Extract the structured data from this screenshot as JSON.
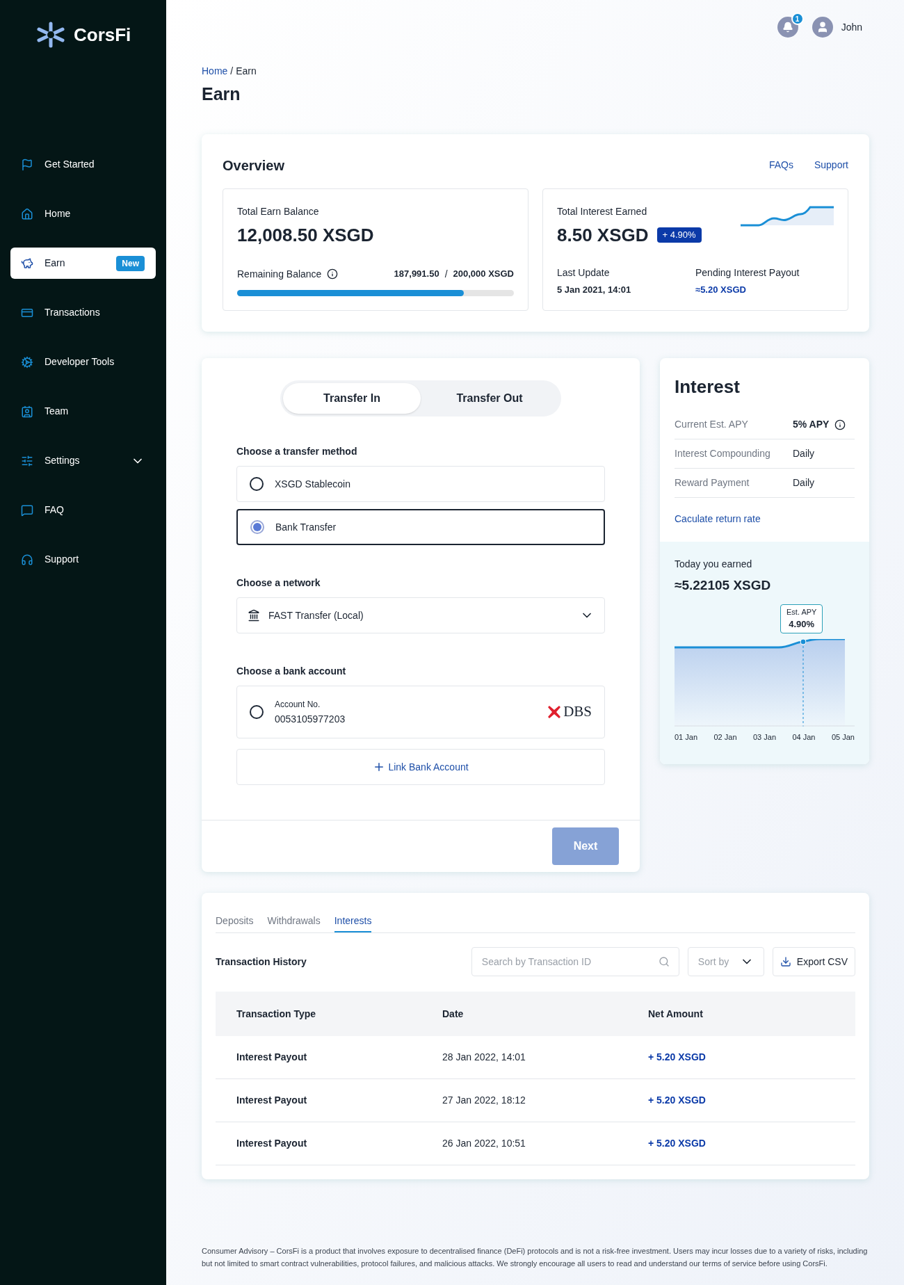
{
  "brand": "CorsFi",
  "sidebar": {
    "items": [
      {
        "label": "Get Started",
        "kind": "link",
        "selected": false
      },
      {
        "label": "Home",
        "kind": "link",
        "selected": false
      },
      {
        "label": "Earn",
        "kind": "link",
        "selected": true,
        "badge": "New"
      },
      {
        "label": "Transactions",
        "kind": "link",
        "selected": false
      },
      {
        "label": "Developer Tools",
        "kind": "link",
        "selected": false
      },
      {
        "label": "Team",
        "kind": "link",
        "selected": false
      },
      {
        "label": "Settings",
        "kind": "group",
        "selected": false,
        "expanded": false
      },
      {
        "label": "FAQ",
        "kind": "link",
        "selected": false
      },
      {
        "label": "Support",
        "kind": "link",
        "selected": false
      }
    ]
  },
  "header": {
    "notification_count": "1",
    "user_name": "John"
  },
  "breadcrumb": {
    "link": "Home",
    "separator": "/",
    "current": "Earn"
  },
  "page_title": "Earn",
  "overview": {
    "title": "Overview",
    "links": [
      "FAQs",
      "Support"
    ],
    "balance": {
      "label": "Total Earn Balance",
      "value": "12,008.50 XSGD",
      "remaining_label": "Remaining Balance",
      "remaining_used": "187,991.50",
      "remaining_separator": "/",
      "remaining_total": "200,000 XSGD",
      "level": 0.82
    },
    "interest": {
      "label": "Total Interest Earned",
      "value": "8.50 XSGD",
      "change": "+ 4.90%",
      "last_update_label": "Last Update",
      "last_update": "5 Jan 2021, 14:01",
      "pending_label": "Pending Interest Payout",
      "pending": "≈5.20 XSGD"
    }
  },
  "transfer": {
    "tabs": [
      {
        "label": "Transfer In",
        "selected": true
      },
      {
        "label": "Transfer Out",
        "selected": false
      }
    ],
    "method_label": "Choose a transfer method",
    "methods": [
      {
        "label": "XSGD Stablecoin",
        "selected": false
      },
      {
        "label": "Bank Transfer",
        "selected": true
      }
    ],
    "network_label": "Choose a network",
    "network": "FAST Transfer (Local)",
    "account_label": "Choose a bank account",
    "accounts": [
      {
        "label": "Account No.",
        "number": "0053105977203",
        "bank": "DBS",
        "selected": false
      }
    ],
    "link_account": "Link Bank Account",
    "next": "Next",
    "next_disabled": true
  },
  "interest": {
    "title": "Interest",
    "rows": [
      {
        "label": "Current Est. APY",
        "value": "5% APY",
        "info": true
      },
      {
        "label": "Interest Compounding",
        "value": "Daily",
        "info": false
      },
      {
        "label": "Reward Payment",
        "value": "Daily",
        "info": false
      }
    ],
    "link": "Caculate return rate",
    "today_label": "Today you earned",
    "today_value": "≈5.22105 XSGD",
    "tooltip_label": "Est. APY",
    "tooltip_value": "4.90%",
    "x_labels": [
      "01 Jan",
      "02 Jan",
      "03 Jan",
      "04 Jan",
      "05 Jan"
    ]
  },
  "history": {
    "tabs": [
      {
        "label": "Deposits",
        "selected": false
      },
      {
        "label": "Withdrawals",
        "selected": false
      },
      {
        "label": "Interests",
        "selected": true
      }
    ],
    "title": "Transaction History",
    "search": {
      "placeholder": "Search by Transaction ID"
    },
    "sort": "Sort by",
    "export": "Export CSV",
    "columns": [
      "Transaction Type",
      "Date",
      "Net Amount"
    ],
    "rows": [
      {
        "type": "Interest Payout",
        "date": "28 Jan 2022, 14:01",
        "amount": "+ 5.20 XSGD"
      },
      {
        "type": "Interest Payout",
        "date": "27 Jan 2022, 18:12",
        "amount": "+ 5.20 XSGD"
      },
      {
        "type": "Interest Payout",
        "date": "26 Jan 2022, 10:51",
        "amount": "+ 5.20 XSGD"
      }
    ]
  },
  "footer": "Consumer Advisory – CorsFi is a product that involves exposure to decentralised finance (DeFi) protocols and is not a risk-free investment. Users may incur losses due to a variety of risks, including but not limited to smart contract vulnerabilities, protocol failures, and malicious attacks. We strongly encourage all users to read and understand our terms of service before using CorsFi."
}
